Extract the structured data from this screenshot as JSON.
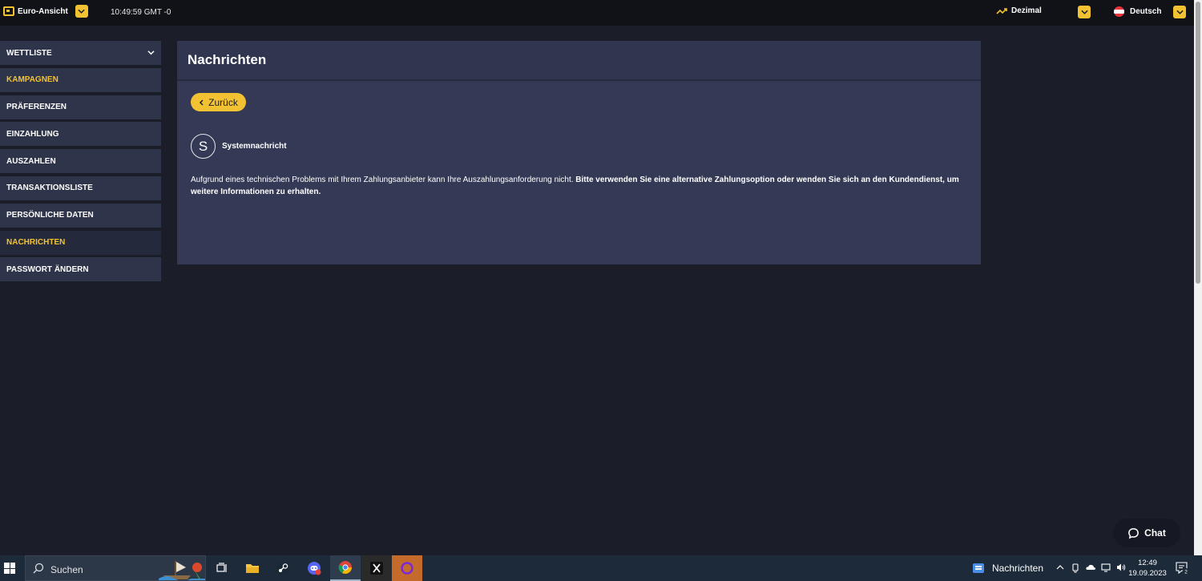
{
  "topbar": {
    "view_label": "Euro-Ansicht",
    "time": "10:49:59 GMT -0",
    "odds_label": "Dezimal",
    "language_label": "Deutsch"
  },
  "sidebar": {
    "items": [
      {
        "label": "WETTLISTE"
      },
      {
        "label": "KAMPAGNEN"
      },
      {
        "label": "PRÄFERENZEN"
      },
      {
        "label": "EINZAHLUNG"
      },
      {
        "label": "AUSZAHLEN"
      },
      {
        "label": "TRANSAKTIONSLISTE"
      },
      {
        "label": "PERSÖNLICHE DATEN"
      },
      {
        "label": "NACHRICHTEN"
      },
      {
        "label": "PASSWORT ÄNDERN"
      }
    ]
  },
  "main": {
    "title": "Nachrichten",
    "back_label": "Zurück",
    "message": {
      "avatar_letter": "S",
      "sender": "Systemnachricht",
      "text_normal": "Aufgrund eines technischen Problems mit Ihrem Zahlungsanbieter kann Ihre Auszahlungsanforderung nicht.",
      "text_bold": "Bitte verwenden Sie eine alternative Zahlungsoption oder wenden Sie sich an den Kundendienst, um weitere Informationen zu erhalten."
    }
  },
  "chat": {
    "label": "Chat"
  },
  "taskbar": {
    "search_placeholder": "Suchen",
    "news_label": "Nachrichten",
    "time": "12:49",
    "date": "19.09.2023",
    "notification_count": "2"
  },
  "colors": {
    "accent": "#f3c233",
    "background": "#1b1e29",
    "panel": "#343a55",
    "sidebar_item": "#2e3449"
  }
}
